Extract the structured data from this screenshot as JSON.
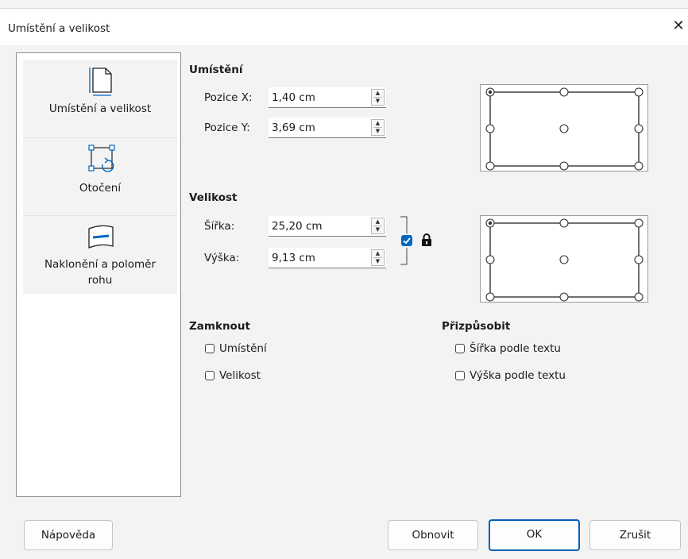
{
  "window": {
    "title": "Umístění a velikost",
    "close_glyph": "✕"
  },
  "sidebar": {
    "items": [
      {
        "label": "Umístění a velikost",
        "icon": "page-position-icon"
      },
      {
        "label": "Otočení",
        "icon": "rotate-icon"
      },
      {
        "label_line1": "Naklonění a poloměr",
        "label_line2": "rohu",
        "icon": "slant-icon"
      }
    ]
  },
  "position": {
    "title": "Umístění",
    "x_label": "Pozice X:",
    "x_value": "1,40 cm",
    "y_label": "Pozice Y:",
    "y_value": "3,69 cm"
  },
  "size": {
    "title": "Velikost",
    "width_label": "Šířka:",
    "width_value": "25,20 cm",
    "height_label": "Výška:",
    "height_value": "9,13 cm",
    "keep_ratio_checked": true
  },
  "lock": {
    "title": "Zamknout",
    "position_label": "Umístění",
    "size_label": "Velikost"
  },
  "fit": {
    "title": "Přizpůsobit",
    "width_label": "Šířka podle textu",
    "height_label": "Výška podle textu"
  },
  "buttons": {
    "help": "Nápověda",
    "reset": "Obnovit",
    "ok": "OK",
    "cancel": "Zrušit"
  },
  "colors": {
    "accent": "#005fb8",
    "checkbox_checked": "#0067c0"
  }
}
